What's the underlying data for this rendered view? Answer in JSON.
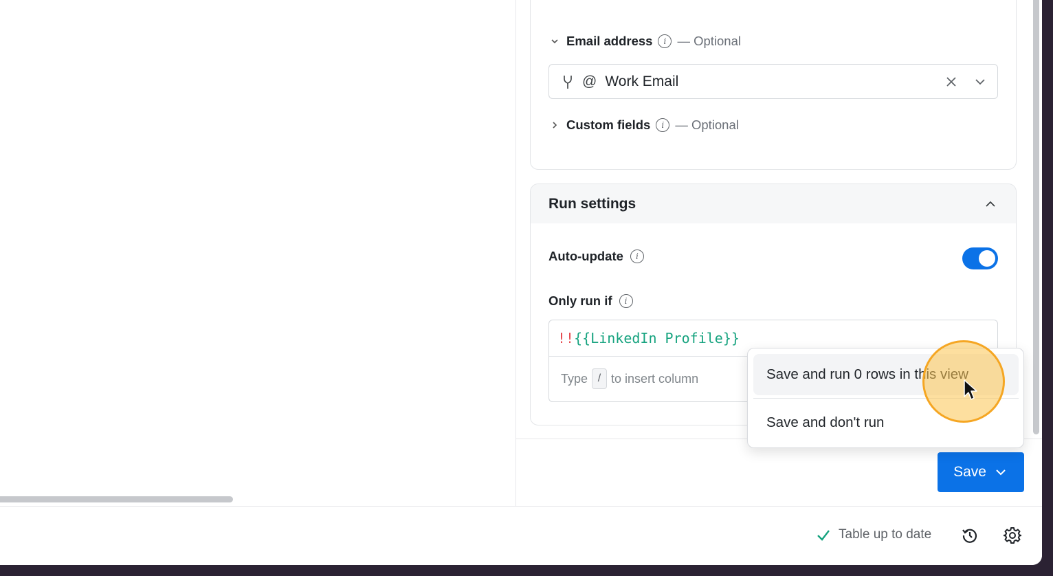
{
  "mapping": {
    "email_label": "Email address",
    "email_optional": "— Optional",
    "email_value": "Work Email",
    "custom_label": "Custom fields",
    "custom_optional": "— Optional"
  },
  "run_settings": {
    "title": "Run settings",
    "auto_update_label": "Auto-update",
    "auto_update_on": true,
    "only_run_if_label": "Only run if",
    "formula_negation": "!!",
    "formula_variable": "{{LinkedIn Profile}}",
    "hint_prefix": "Type",
    "hint_key": "/",
    "hint_suffix": "to insert column"
  },
  "save_menu": {
    "item1": "Save and run 0 rows in this view",
    "item2": "Save and don't run"
  },
  "save_button": {
    "label": "Save"
  },
  "status_bar": {
    "status_text": "Table up to date"
  },
  "colors": {
    "accent": "#0b72e7",
    "formula_var": "#16a37f",
    "formula_neg": "#e5484d",
    "success": "#16a37f"
  },
  "icons": [
    "info-icon",
    "merge-icon",
    "at-icon",
    "close-icon",
    "chevron-down-icon",
    "chevron-right-icon",
    "chevron-up-icon",
    "check-icon",
    "history-icon",
    "gear-icon",
    "cursor-icon"
  ]
}
